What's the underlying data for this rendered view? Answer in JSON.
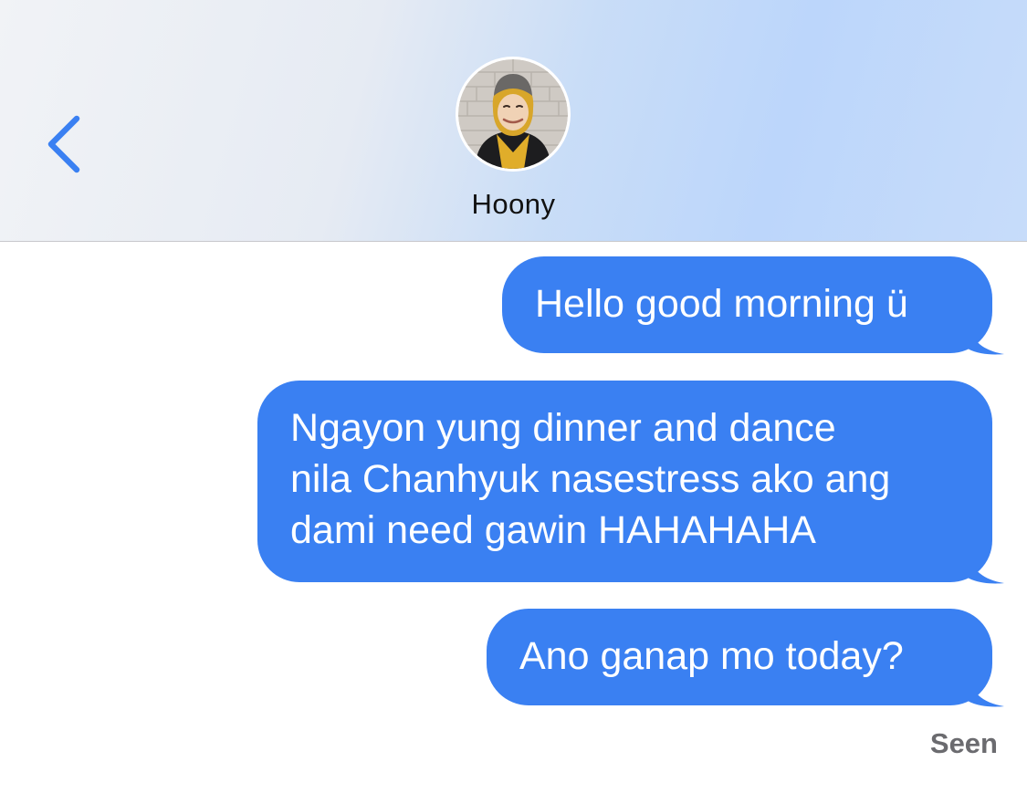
{
  "header": {
    "back_icon": "chevron-left-icon",
    "contact_name": "Hoony",
    "avatar": "contact-avatar-photo"
  },
  "messages": [
    {
      "direction": "sent",
      "text": "Hello good morning ü"
    },
    {
      "direction": "sent",
      "text": "Ngayon yung dinner and dance\nnila Chanhyuk nasestress ako ang\ndami need gawin HAHAHAHA"
    },
    {
      "direction": "sent",
      "text": "Ano ganap mo today?"
    }
  ],
  "status": {
    "receipt": "Seen"
  },
  "colors": {
    "accent": "#3a80f2",
    "bubble_text": "#ffffff",
    "receipt_text": "#6b6b6f"
  }
}
